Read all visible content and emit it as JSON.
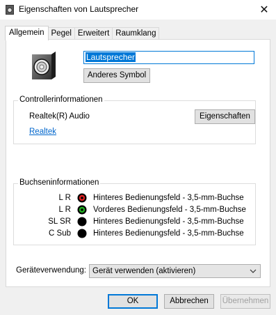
{
  "window": {
    "title": "Eigenschaften von Lautsprecher",
    "close_glyph": "✕"
  },
  "tabs": [
    {
      "label": "Allgemein",
      "active": true
    },
    {
      "label": "Pegel",
      "active": false
    },
    {
      "label": "Erweitert",
      "active": false
    },
    {
      "label": "Raumklang",
      "active": false
    }
  ],
  "general": {
    "device_name": "Lautsprecher",
    "change_icon_label": "Anderes Symbol",
    "device_icon": "speaker-icon"
  },
  "controller": {
    "group_title": "Controllerinformationen",
    "name": "Realtek(R) Audio",
    "properties_label": "Eigenschaften",
    "vendor_link": "Realtek"
  },
  "jacks": {
    "group_title": "Buchseninformationen",
    "rows": [
      {
        "channels": "L R",
        "description": "Hinteres Bedienungsfeld - 3,5-mm-Buchse",
        "color": "#e02020"
      },
      {
        "channels": "L R",
        "description": "Vorderes Bedienungsfeld - 3,5-mm-Buchse",
        "color": "#20b020"
      },
      {
        "channels": "SL SR",
        "description": "Hinteres Bedienungsfeld - 3,5-mm-Buchse",
        "color": "#000000"
      },
      {
        "channels": "C Sub",
        "description": "Hinteres Bedienungsfeld - 3,5-mm-Buchse",
        "color": "#000000"
      }
    ]
  },
  "usage": {
    "label": "Geräteverwendung:",
    "selected": "Gerät verwenden (aktivieren)"
  },
  "buttons": {
    "ok": "OK",
    "cancel": "Abbrechen",
    "apply": "Übernehmen"
  },
  "colors": {
    "accent": "#0078d7",
    "link": "#0066cc"
  }
}
